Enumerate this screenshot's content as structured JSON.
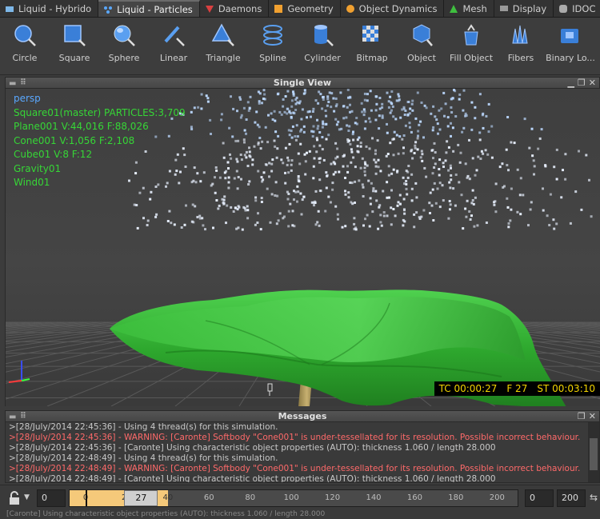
{
  "tabs": [
    {
      "label": "Liquid - Hybrido",
      "icon": "liquid-hybrido-icon",
      "active": false
    },
    {
      "label": "Liquid - Particles",
      "icon": "liquid-particles-icon",
      "active": true
    },
    {
      "label": "Daemons",
      "icon": "daemons-icon",
      "active": false
    },
    {
      "label": "Geometry",
      "icon": "geometry-icon",
      "active": false
    },
    {
      "label": "Object Dynamics",
      "icon": "object-dynamics-icon",
      "active": false
    },
    {
      "label": "Mesh",
      "icon": "mesh-icon",
      "active": false
    },
    {
      "label": "Display",
      "icon": "display-icon",
      "active": false
    },
    {
      "label": "IDOC",
      "icon": "idoc-icon",
      "active": false
    }
  ],
  "tools": [
    {
      "label": "Circle",
      "icon": "circle-emitter-icon"
    },
    {
      "label": "Square",
      "icon": "square-emitter-icon"
    },
    {
      "label": "Sphere",
      "icon": "sphere-emitter-icon"
    },
    {
      "label": "Linear",
      "icon": "linear-emitter-icon"
    },
    {
      "label": "Triangle",
      "icon": "triangle-emitter-icon"
    },
    {
      "label": "Spline",
      "icon": "spline-emitter-icon"
    },
    {
      "label": "Cylinder",
      "icon": "cylinder-emitter-icon"
    },
    {
      "label": "Bitmap",
      "icon": "bitmap-emitter-icon"
    },
    {
      "label": "Object",
      "icon": "object-emitter-icon"
    },
    {
      "label": "Fill Object",
      "icon": "fill-object-emitter-icon"
    },
    {
      "label": "Fibers",
      "icon": "fibers-emitter-icon"
    },
    {
      "label": "Binary Lo...",
      "icon": "binary-loader-icon"
    }
  ],
  "viewport": {
    "title": "Single View",
    "info_lines": [
      "persp",
      "Square01(master) PARTICLES:3,709",
      "Plane001 V:44,016 F:88,026",
      "Cone001 V:1,056 F:2,108",
      "Cube01 V:8 F:12",
      "Gravity01",
      "Wind01"
    ],
    "hud": {
      "tc": "TC 00:00:27",
      "frame": "F 27",
      "st": "ST 00:03:10"
    }
  },
  "messages": {
    "title": "Messages",
    "lines": [
      {
        "text": ">[28/July/2014 22:45:36] - Using 4 thread(s) for this simulation.",
        "type": "info"
      },
      {
        "text": ">[28/July/2014 22:45:36] - WARNING: [Caronte] Softbody \"Cone001\" is under-tessellated for its resolution. Possible incorrect behaviour.",
        "type": "warn"
      },
      {
        "text": ">[28/July/2014 22:45:36] - [Caronte] Using characteristic object properties (AUTO): thickness 1.060 / length 28.000",
        "type": "info"
      },
      {
        "text": ">[28/July/2014 22:48:49] - Using 4 thread(s) for this simulation.",
        "type": "info"
      },
      {
        "text": ">[28/July/2014 22:48:49] - WARNING: [Caronte] Softbody \"Cone001\" is under-tessellated for its resolution. Possible incorrect behaviour.",
        "type": "warn"
      },
      {
        "text": ">[28/July/2014 22:48:49] - [Caronte] Using characteristic object properties (AUTO): thickness 1.060 / length 28.000",
        "type": "info"
      }
    ]
  },
  "timeline": {
    "start_field": "0",
    "range_start_field": "0",
    "range_end_field": "200",
    "current_frame": "27",
    "current_frame_value": 27,
    "cached_until": 40,
    "range_max": 210,
    "ticks": [
      "0",
      "20",
      "40",
      "60",
      "80",
      "100",
      "120",
      "140",
      "160",
      "180",
      "200"
    ]
  },
  "status_text": "[Caronte] Using characteristic object properties (AUTO): thickness 1.060 / length 28.000",
  "colors": {
    "info_text": "#36d636",
    "warning_text": "#ff6a6a",
    "hud_text": "#f3d400",
    "cache_fill": "#f5c97a"
  }
}
